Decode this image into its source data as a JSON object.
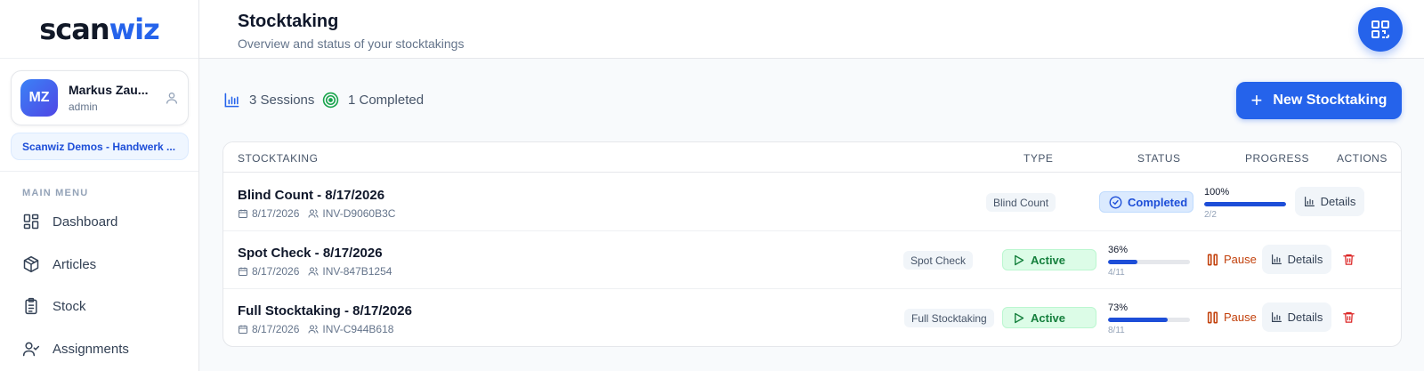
{
  "app": {
    "logo_part1": "scan",
    "logo_part2": "wiz",
    "brand_color": "#2563eb"
  },
  "user": {
    "initials": "MZ",
    "name": "Markus Zau...",
    "role": "admin",
    "organization": "Scanwiz Demos - Handwerk ..."
  },
  "menu": {
    "title": "MAIN MENU",
    "items": [
      {
        "label": "Dashboard",
        "icon": "dashboard-icon"
      },
      {
        "label": "Articles",
        "icon": "box-icon"
      },
      {
        "label": "Stock",
        "icon": "clipboard-icon"
      },
      {
        "label": "Assignments",
        "icon": "user-check-icon"
      }
    ]
  },
  "header": {
    "title": "Stocktaking",
    "subtitle": "Overview and status of your stocktakings",
    "qr_icon": "qr-code-icon"
  },
  "stats": {
    "sessions": "3 Sessions",
    "completed": "1 Completed"
  },
  "new_button": "New Stocktaking",
  "table": {
    "columns": [
      "STOCKTAKING",
      "TYPE",
      "STATUS",
      "PROGRESS",
      "ACTIONS"
    ],
    "rows": [
      {
        "name": "Blind Count - 8/17/2026",
        "date": "8/17/2026",
        "id": "INV-D9060B3C",
        "type": "Blind Count",
        "status": "Completed",
        "progress_pct": "100%",
        "progress_value": 1.0,
        "progress_count": "2/2",
        "details_label": "Details"
      },
      {
        "name": "Spot Check - 8/17/2026",
        "date": "8/17/2026",
        "id": "INV-847B1254",
        "type": "Spot Check",
        "status": "Active",
        "progress_pct": "36%",
        "progress_value": 0.36,
        "progress_count": "4/11",
        "pause_label": "Pause",
        "details_label": "Details"
      },
      {
        "name": "Full Stocktaking - 8/17/2026",
        "date": "8/17/2026",
        "id": "INV-C944B618",
        "type": "Full Stocktaking",
        "status": "Active",
        "progress_pct": "73%",
        "progress_value": 0.73,
        "progress_count": "8/11",
        "pause_label": "Pause",
        "details_label": "Details"
      }
    ]
  },
  "colors": {
    "completed": "#1d4ed8",
    "active": "#15803d",
    "pause": "#c2410c",
    "delete": "#dc2626"
  }
}
